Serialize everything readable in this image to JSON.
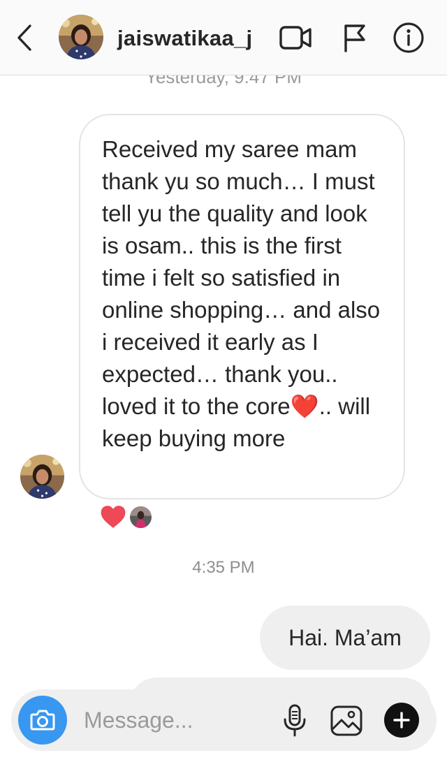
{
  "header": {
    "username": "jaiswatikaa_j",
    "icons": [
      "back-chevron-icon",
      "video-call-icon",
      "report-flag-icon",
      "info-icon"
    ]
  },
  "chat": {
    "day_stamp": "Yesterday, 9:47 PM",
    "incoming_message": "Received my saree mam thank yu so much… I must tell yu the quality and look is osam.. this is the first time i felt so satisfied in online shopping… and also i received it early as I expected… thank you.. loved it to the core❤️.. will keep buying more",
    "reaction": "heart",
    "time_stamp": "4:35 PM",
    "outgoing_message": "Hai. Ma’am"
  },
  "composer": {
    "placeholder": "Message...",
    "icons": [
      "camera-icon",
      "microphone-icon",
      "gallery-icon",
      "plus-icon"
    ]
  },
  "colors": {
    "camera_button": "#3897f0",
    "bubble_out": "#efefef",
    "heart": "#ed4956",
    "header_bg": "#fafafa"
  }
}
